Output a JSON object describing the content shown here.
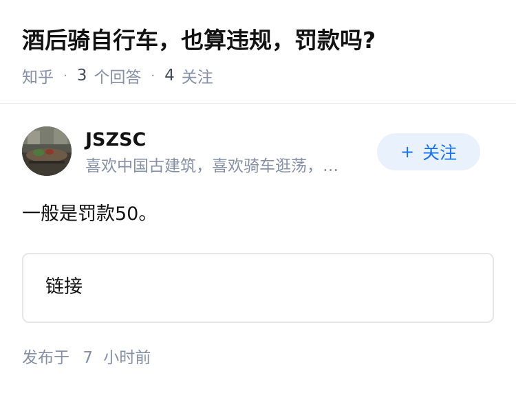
{
  "question": {
    "title": "酒后骑自行车，也算违规，罚款吗?",
    "source": "知乎",
    "answer_count": "3",
    "answer_label": "个回答",
    "follow_count": "4",
    "follow_label": "关注"
  },
  "author": {
    "name": "JSZSC",
    "bio": "喜欢中国古建筑，喜欢骑车逛荡，…",
    "avatar_icon": "avatar-photo",
    "follow_button": {
      "icon": "plus-icon",
      "plus": "+",
      "label": "关注"
    }
  },
  "answer": {
    "content": "一般是罚款50。",
    "link_card_label": "链接"
  },
  "publish": {
    "prefix": "发布于",
    "value": "7",
    "suffix": "小时前"
  },
  "colors": {
    "accent": "#1772f6",
    "follow_bg": "#e8f1fc",
    "meta_gray": "#8590a6"
  }
}
